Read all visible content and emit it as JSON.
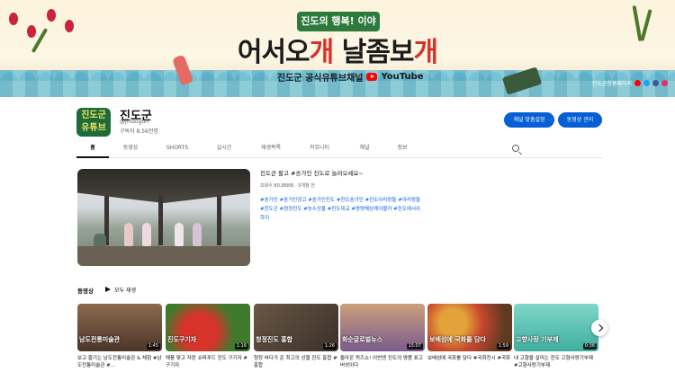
{
  "banner": {
    "tag": "진도의 행복! 이야기",
    "headline_parts": [
      "어서오",
      "개",
      " 날좀보",
      "개"
    ],
    "subline": "진도군 공식유튜브채널",
    "youtube": "YouTube",
    "link_label": "진도군청홈페이지"
  },
  "channel": {
    "avatar_text": "진도군 유튜브",
    "name": "진도군",
    "handle": "@jindogun",
    "subscribers": "구독자 8.56천명",
    "customize_label": "채널 맞춤설정",
    "manage_label": "동영상 관리"
  },
  "tabs": [
    "홈",
    "동영상",
    "SHORTS",
    "실시간",
    "재생목록",
    "커뮤니티",
    "채널",
    "정보"
  ],
  "featured": {
    "title": "진도군 팔고 #송가인 진도로 놀러오세요~",
    "meta": "조회수 80,888회 · 5개월 전",
    "tags": "#송가인 #송가인광고 #송가인진도 #진도송가인 #진도아리랑들 #아리랑들 #진도군 #청정진도 #농수산물 #진도대교 #명량해상케이블카 #진도에서쉬하지"
  },
  "section": {
    "title": "동영상",
    "play_all": "모두 재생"
  },
  "videos": [
    {
      "caption": "남도전통미술관",
      "duration": "1:45",
      "title": "보고 즐기는 남도전통미술관 & 체험 #남도전통미술관 #...",
      "color": "#6b4f3a"
    },
    {
      "caption": "진도구기자",
      "duration": "1:16",
      "title": "해풍 맞고 자란 슈퍼푸드 진도 구기자 #구기자",
      "color": "#b8322a"
    },
    {
      "caption": "청정진도 홍합",
      "duration": "1:26",
      "title": "청정 바다가 준 최고의 선물 진도 홍합 #홍합",
      "color": "#5a4a3d"
    },
    {
      "caption": "화순글로벌뉴스",
      "duration": "15:07",
      "title": "돌아온 퀴즈쇼! 이번엔 진도의 명품 표고버섯이다",
      "color": "#7b5b8e"
    },
    {
      "caption": "보배섬에 국화를 담다",
      "duration": "1:59",
      "title": "보배섬에 국화를 담다 #국화전시 #국화",
      "color": "#8a4a2c"
    },
    {
      "caption": "고향사랑 기부제",
      "duration": "0:36",
      "title": "내 고향을 살리는 진도 고향사랑기부제 #고향사랑기부제",
      "color": "#3fae9e"
    }
  ]
}
